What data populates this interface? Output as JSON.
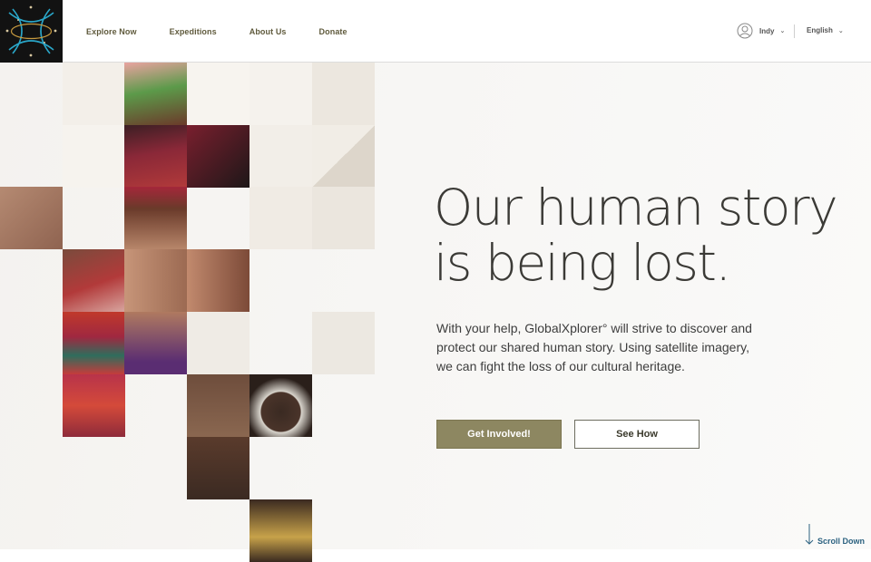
{
  "nav": {
    "items": [
      {
        "label": "Explore Now"
      },
      {
        "label": "Expeditions"
      },
      {
        "label": "About Us"
      },
      {
        "label": "Donate"
      }
    ]
  },
  "user": {
    "name": "Indy",
    "icon": "user-circle-icon"
  },
  "language": {
    "selected": "English"
  },
  "hero": {
    "headline_line1": "Our human story",
    "headline_line2": "is being lost.",
    "body": "With your help, GlobalXplorer° will strive to discover and protect our shared human story. Using satellite imagery, we can fight the loss of our cultural heritage.",
    "primary_button": "Get Involved!",
    "secondary_button": "See How",
    "scroll_label": "Scroll Down"
  },
  "colors": {
    "accent": "#8d8761",
    "nav_text": "#5f5a3c",
    "scroll_text": "#2c6280",
    "logo_bg": "#121212",
    "logo_lines": "#2aa7c9"
  }
}
